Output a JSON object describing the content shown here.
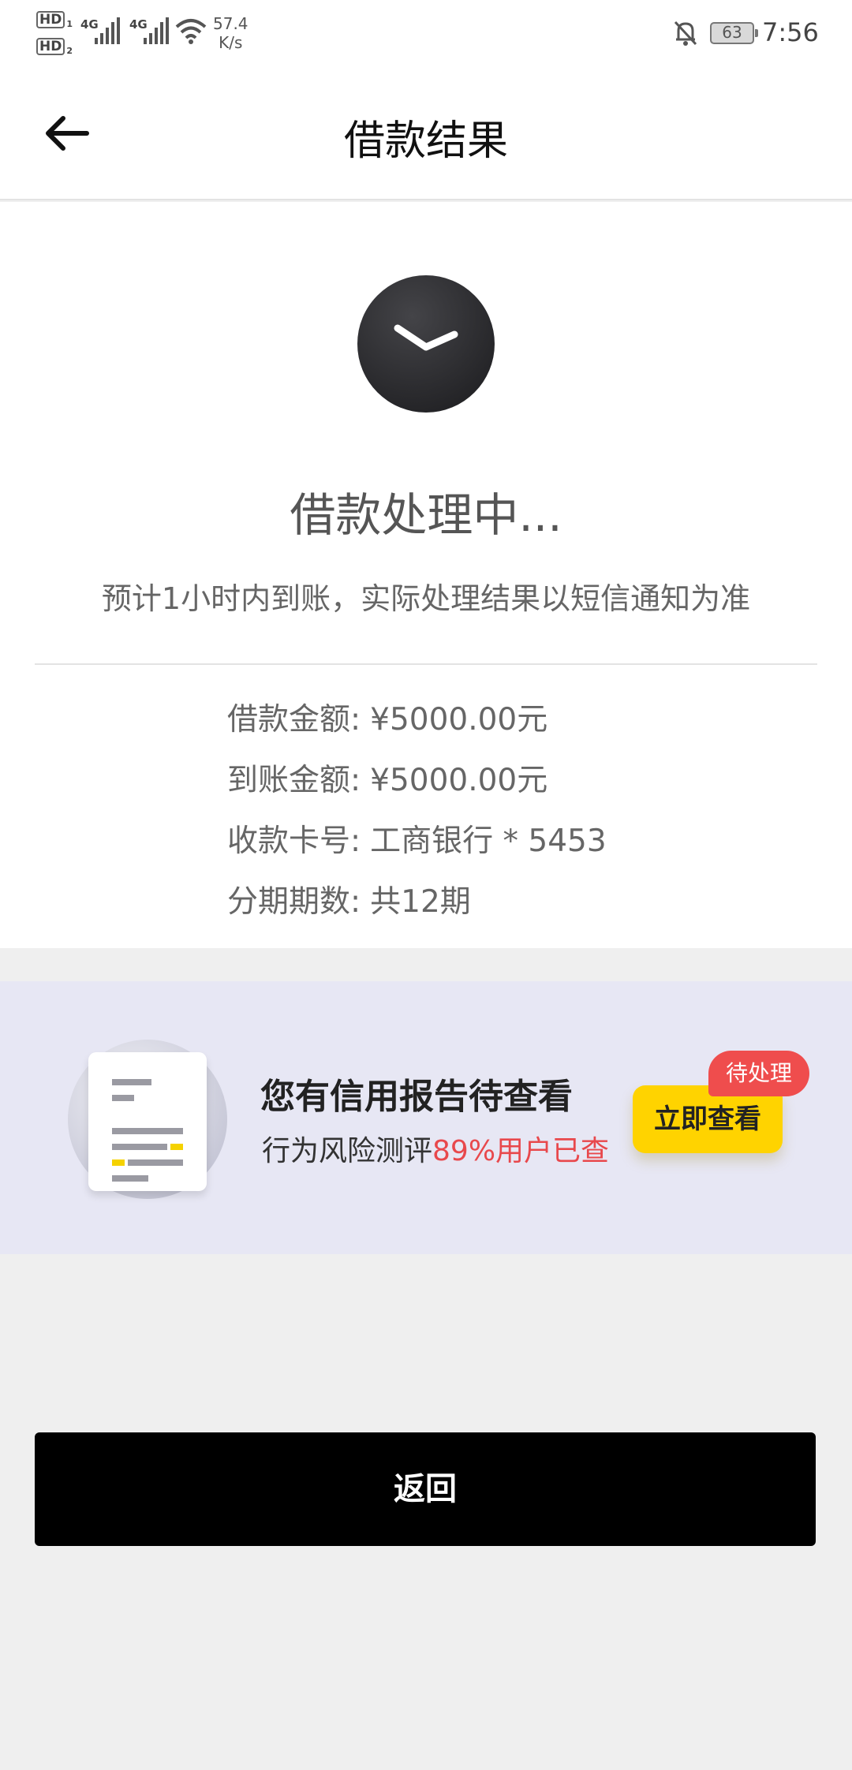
{
  "status_bar": {
    "sim1_label": "HD",
    "sim1_index": "1",
    "sim2_label": "HD",
    "sim2_index": "2",
    "net1": "4G",
    "net2": "4G",
    "speed_value": "57.4",
    "speed_unit": "K/s",
    "battery": "63",
    "time": "7:56"
  },
  "navbar": {
    "title": "借款结果"
  },
  "result": {
    "status_title": "借款处理中...",
    "status_note": "预计1小时内到账，实际处理结果以短信通知为准",
    "details": [
      {
        "label": "借款金额:",
        "value": "¥5000.00元"
      },
      {
        "label": "到账金额:",
        "value": "¥5000.00元"
      },
      {
        "label": "收款卡号:",
        "value": "工商银行 * 5453"
      },
      {
        "label": "分期期数:",
        "value": "共12期"
      }
    ]
  },
  "banner": {
    "title": "您有信用报告待查看",
    "subtitle_prefix": "行为风险测评",
    "subtitle_highlight": "89%用户已查",
    "button_label": "立即查看",
    "badge_label": "待处理"
  },
  "footer": {
    "return_label": "返回"
  },
  "colors": {
    "accent_yellow": "#ffd300",
    "badge_red": "#ef4d4d",
    "banner_bg": "#e7e7f4",
    "highlight_red": "#e8484c"
  },
  "icons": {
    "back": "arrow-left-icon",
    "clock": "clock-icon",
    "document": "report-document-icon",
    "bell": "bell-muted-icon",
    "wifi": "wifi-icon"
  }
}
